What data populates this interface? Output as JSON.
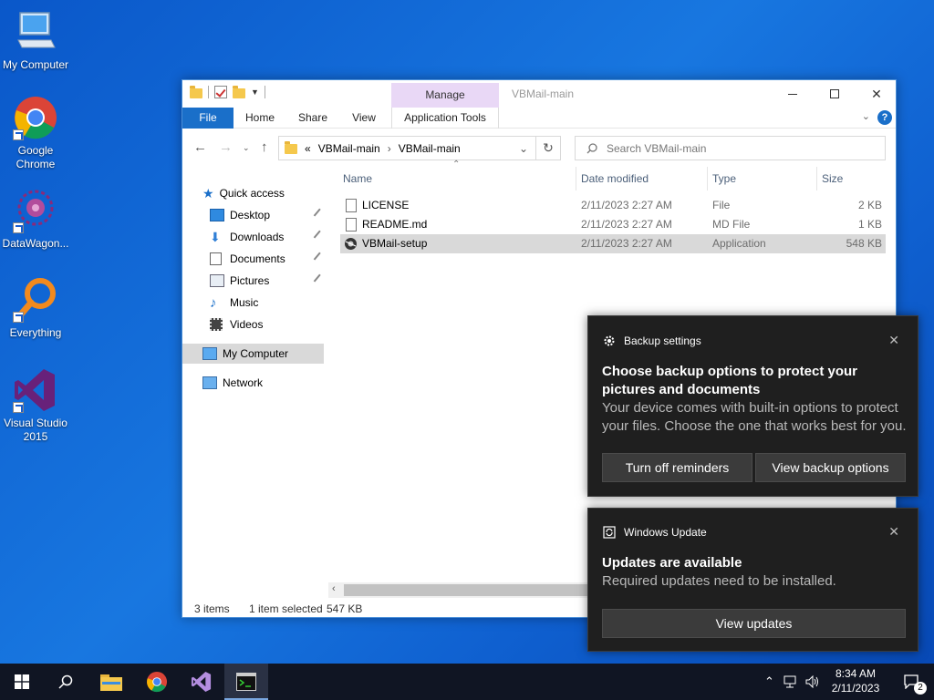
{
  "desktop": {
    "icons": [
      {
        "label": "My Computer",
        "icon": "computer-icon"
      },
      {
        "label": "Google Chrome",
        "icon": "chrome-icon"
      },
      {
        "label": "DataWagon...",
        "icon": "datawagon-icon"
      },
      {
        "label": "Everything",
        "icon": "everything-search-icon"
      },
      {
        "label": "Visual Studio 2015",
        "icon": "visual-studio-icon"
      }
    ]
  },
  "explorer": {
    "title": "VBMail-main",
    "manage_tab": "Manage",
    "ribbon_tabs": [
      "File",
      "Home",
      "Share",
      "View",
      "Application Tools"
    ],
    "breadcrumb": {
      "prefix": "«",
      "parts": [
        "VBMail-main",
        "VBMail-main"
      ]
    },
    "search_placeholder": "Search VBMail-main",
    "nav": [
      {
        "label": "Quick access",
        "icon": "star-icon"
      },
      {
        "label": "Desktop",
        "icon": "desktop-folder-icon",
        "pinned": true
      },
      {
        "label": "Downloads",
        "icon": "downloads-icon",
        "pinned": true
      },
      {
        "label": "Documents",
        "icon": "documents-icon",
        "pinned": true
      },
      {
        "label": "Pictures",
        "icon": "pictures-icon",
        "pinned": true
      },
      {
        "label": "Music",
        "icon": "music-icon"
      },
      {
        "label": "Videos",
        "icon": "videos-icon"
      },
      {
        "label": "My Computer",
        "icon": "computer-icon",
        "selected": true
      },
      {
        "label": "Network",
        "icon": "network-icon"
      }
    ],
    "columns": [
      "Name",
      "Date modified",
      "Type",
      "Size"
    ],
    "files": [
      {
        "name": "LICENSE",
        "date": "2/11/2023 2:27 AM",
        "type": "File",
        "size": "2 KB"
      },
      {
        "name": "README.md",
        "date": "2/11/2023 2:27 AM",
        "type": "MD File",
        "size": "1 KB"
      },
      {
        "name": "VBMail-setup",
        "date": "2/11/2023 2:27 AM",
        "type": "Application",
        "size": "548 KB",
        "selected": true
      }
    ],
    "status": {
      "items": "3 items",
      "selected": "1 item selected",
      "size": "547 KB"
    }
  },
  "notifications": [
    {
      "app": "Backup settings",
      "icon": "gear-icon",
      "heading": "Choose backup options to protect your pictures and documents",
      "body": "Your device comes with built-in options to protect your files. Choose the one that works best for you.",
      "buttons": [
        "Turn off reminders",
        "View backup options"
      ]
    },
    {
      "app": "Windows Update",
      "icon": "windows-update-icon",
      "heading": "Updates are available",
      "body": "Required updates need to be installed.",
      "buttons": [
        "View updates"
      ]
    }
  ],
  "taskbar": {
    "time": "8:34 AM",
    "date": "2/11/2023",
    "notification_count": "2"
  }
}
